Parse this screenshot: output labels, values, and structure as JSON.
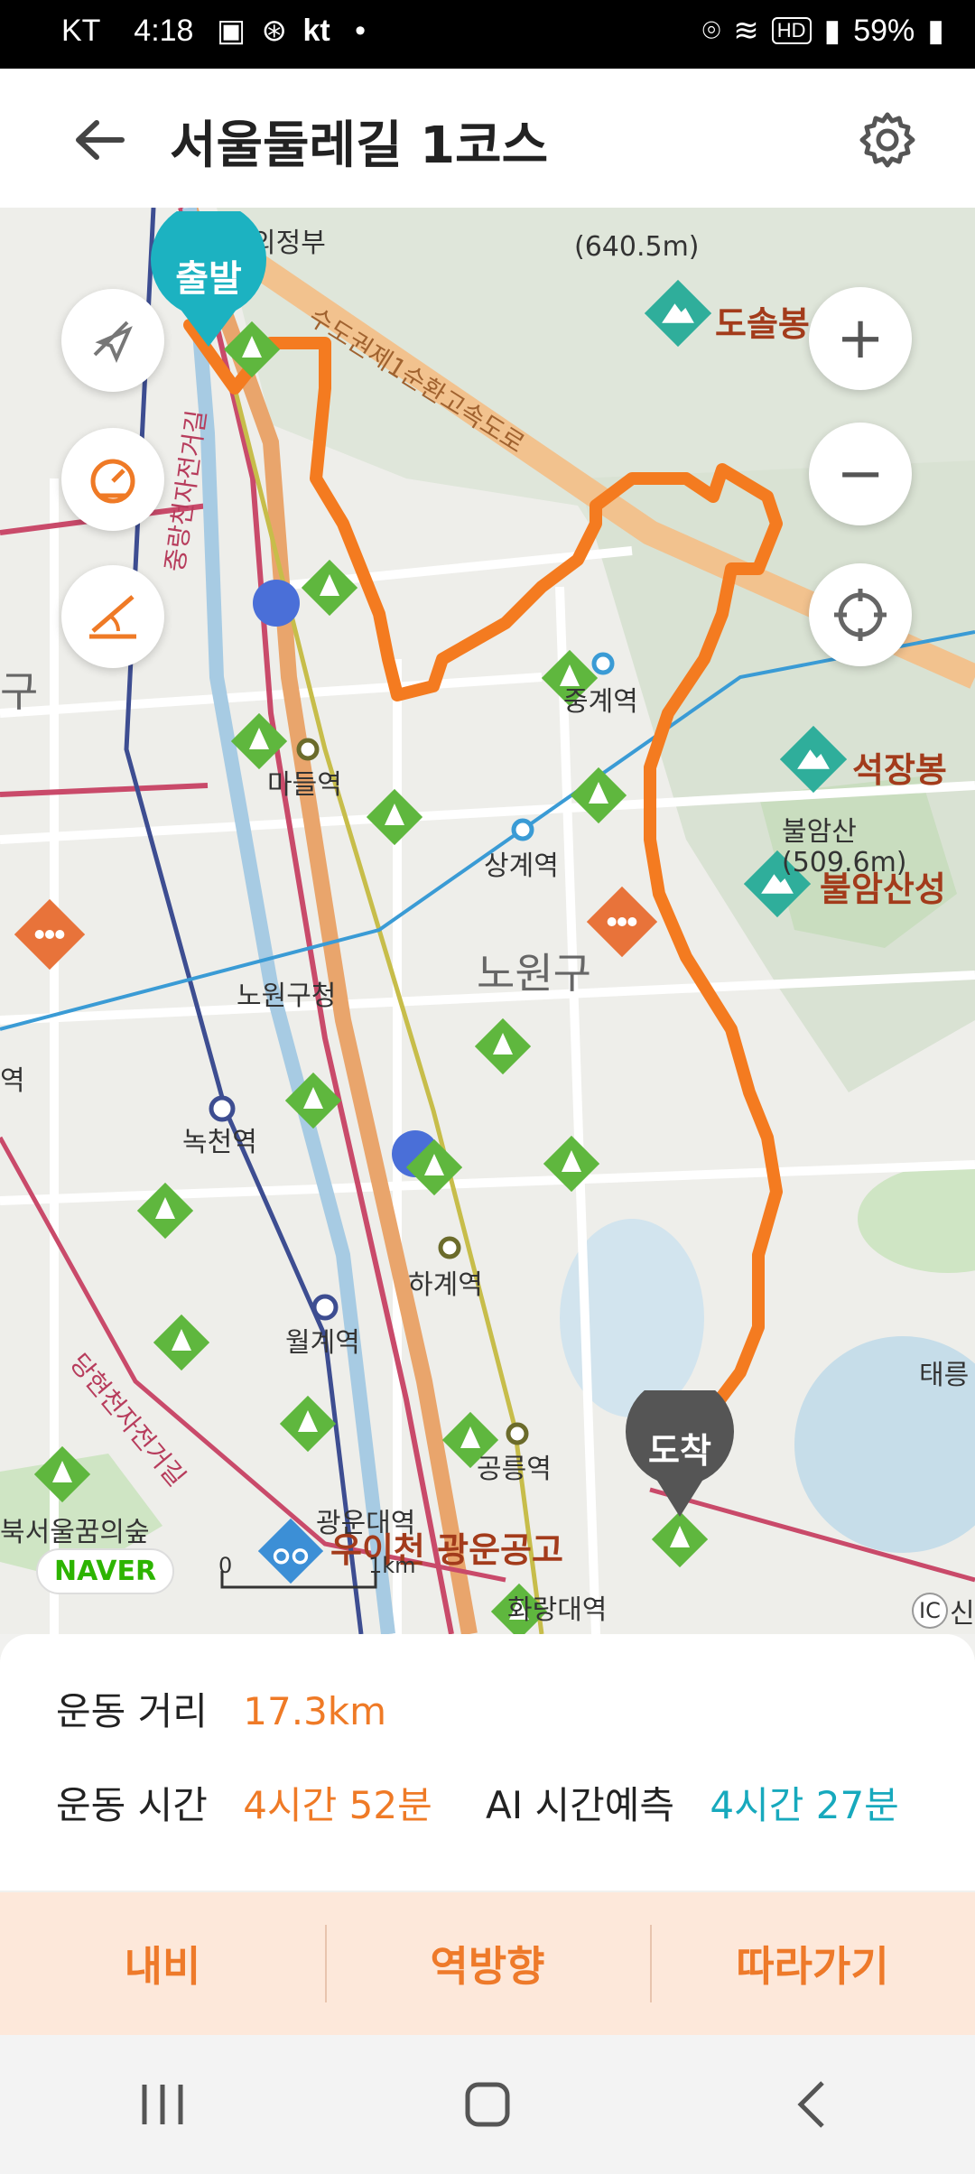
{
  "status_bar": {
    "carrier": "KT",
    "time": "4:18",
    "extra": "kt",
    "battery": "59%"
  },
  "header": {
    "title": "서울둘레길 1코스"
  },
  "map": {
    "start_label": "출발",
    "end_label": "도착",
    "places": {
      "uijeongbu": "의정부",
      "suraksan_alt": "(640.5m)",
      "dosolbong": "도솔봉",
      "seokjangbong": "석장봉",
      "buramsan": "불암산",
      "buramsan_alt": "(509.6m)",
      "buramsanseong": "불암산성",
      "madeul": "마들역",
      "junggye": "중계역",
      "sanggye": "상계역",
      "nowon_office": "노원구청",
      "nowon_gu": "노원구",
      "nokcheon": "녹천역",
      "hagye": "하계역",
      "wolgye": "월계역",
      "gwangun": "광운대역",
      "gongneung": "공릉역",
      "hwarangdae": "화랑대역",
      "ui_park": "우이천 광운공고",
      "forest": "북서울꿈의숲",
      "taereung": "태릉",
      "expressway": "수도권제1순환고속도로",
      "bikeway": "중랑천자전거길",
      "bikeway2": "당현천자전거길",
      "left_gu": "구",
      "left_station": "역",
      "ic": "IC",
      "sin": "신"
    },
    "route_color": "#f47b20",
    "naver_logo": "NAVER",
    "scale_zero": "0",
    "scale_km": "1km",
    "controls": {
      "zoom_in": "+",
      "zoom_out": "−"
    }
  },
  "info": {
    "distance_label": "운동 거리",
    "distance_value": "17.3km",
    "time_label": "운동 시간",
    "time_value": "4시간 52분",
    "ai_label": "AI 시간예측",
    "ai_value": "4시간 27분"
  },
  "tabs": [
    "내비",
    "역방향",
    "따라가기"
  ]
}
